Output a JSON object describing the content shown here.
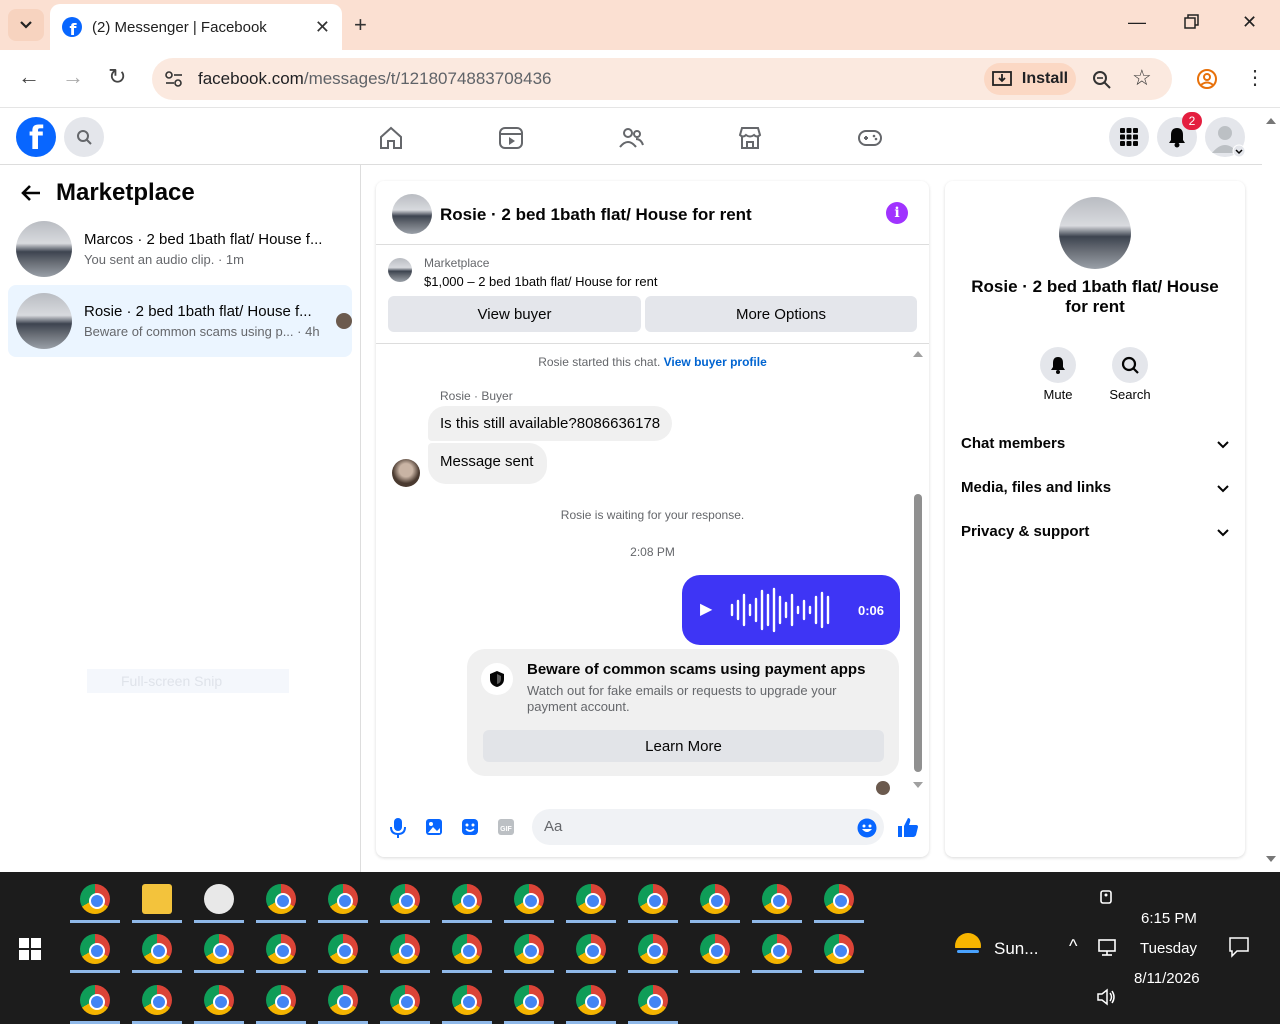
{
  "browser": {
    "tab_title": "(2) Messenger | Facebook",
    "url_host": "facebook.com",
    "url_path": "/messages/t/1218074883708436",
    "install_label": "Install"
  },
  "fb": {
    "notification_count": "2"
  },
  "left": {
    "title": "Marketplace",
    "threads": [
      {
        "name": "Marcos · 2 bed 1bath flat/ House f...",
        "preview": "You sent an audio clip. · 1m"
      },
      {
        "name": "Rosie · 2 bed 1bath flat/ House f...",
        "preview": "Beware of common scams using p... · 4h"
      }
    ],
    "snip_text": "Full-screen Snip"
  },
  "chat": {
    "title": "Rosie · 2 bed 1bath flat/ House for rent",
    "marketplace_label": "Marketplace",
    "listing": "$1,000 – 2 bed 1bath flat/ House for rent",
    "view_buyer": "View buyer",
    "more_options": "More Options",
    "started_text": "Rosie started this chat.",
    "view_buyer_profile": "View buyer profile",
    "sender_label": "Rosie · Buyer",
    "msg1": "Is this still available?8086636178",
    "msg2": "Message sent",
    "waiting": "Rosie is waiting for your response.",
    "time": "2:08 PM",
    "audio_duration": "0:06",
    "warn_title": "Beware of common scams using payment apps",
    "warn_body": "Watch out for fake emails or requests to upgrade your payment account.",
    "learn_more": "Learn More",
    "input_placeholder": "Aa"
  },
  "right": {
    "title": "Rosie · 2 bed 1bath flat/ House for rent",
    "mute": "Mute",
    "search": "Search",
    "sections": [
      "Chat members",
      "Media, files and links",
      "Privacy & support"
    ]
  },
  "taskbar": {
    "weather": "Sun...",
    "time": "6:15 PM",
    "day": "Tuesday",
    "date": "8/11/2026"
  },
  "colors": {
    "fb_blue": "#0866ff",
    "audio_bubble": "#3e35f5",
    "info_purple": "#a033ff",
    "tab_bg": "#fbe0d2"
  }
}
